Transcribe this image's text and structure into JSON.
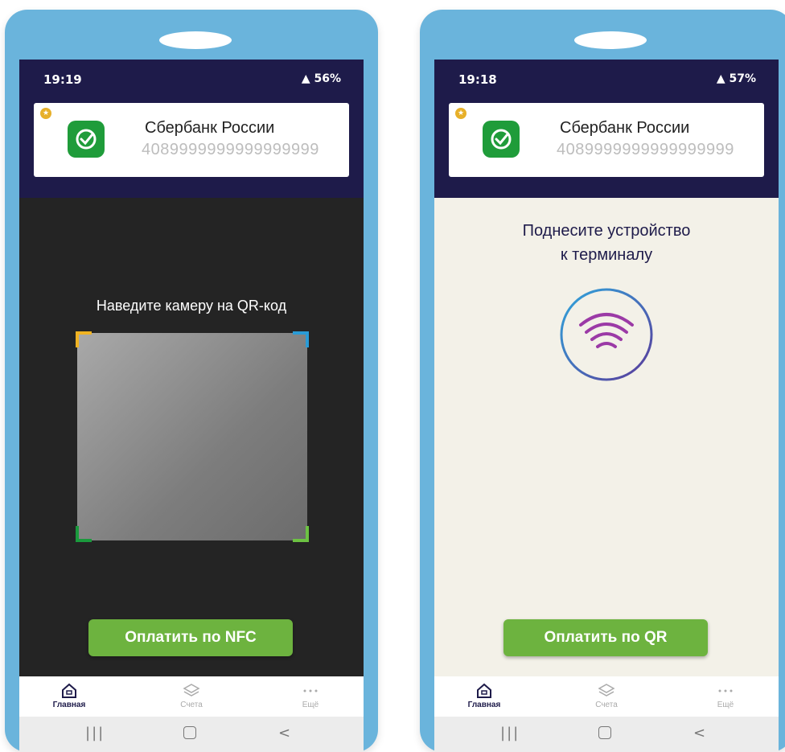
{
  "left_phone": {
    "status_time": "19:19",
    "status_right": "56%",
    "card": {
      "bank_name": "Сбербанк России",
      "account_number": "4089999999999999999"
    },
    "prompt": "Наведите камеру на QR-код",
    "pay_button_label": "Оплатить по NFC",
    "tabs": [
      {
        "label": "Главная",
        "icon": "home-icon",
        "active": true
      },
      {
        "label": "Счета",
        "icon": "layers-icon",
        "active": false
      },
      {
        "label": "Ещё",
        "icon": "more-dots-icon",
        "active": false
      }
    ]
  },
  "right_phone": {
    "status_time": "19:18",
    "status_right": "57%",
    "card": {
      "bank_name": "Сбербанк России",
      "account_number": "4089999999999999999"
    },
    "prompt_line1": "Поднесите устройство",
    "prompt_line2": "к терминалу",
    "pay_button_label": "Оплатить по QR",
    "tabs": [
      {
        "label": "Главная",
        "icon": "home-icon",
        "active": true
      },
      {
        "label": "Счета",
        "icon": "layers-icon",
        "active": false
      },
      {
        "label": "Ещё",
        "icon": "more-dots-icon",
        "active": false
      }
    ]
  },
  "colors": {
    "frame": "#6ab4dc",
    "header": "#1e1b4a",
    "button": "#6db33f",
    "bank_green": "#1f9c3a"
  }
}
